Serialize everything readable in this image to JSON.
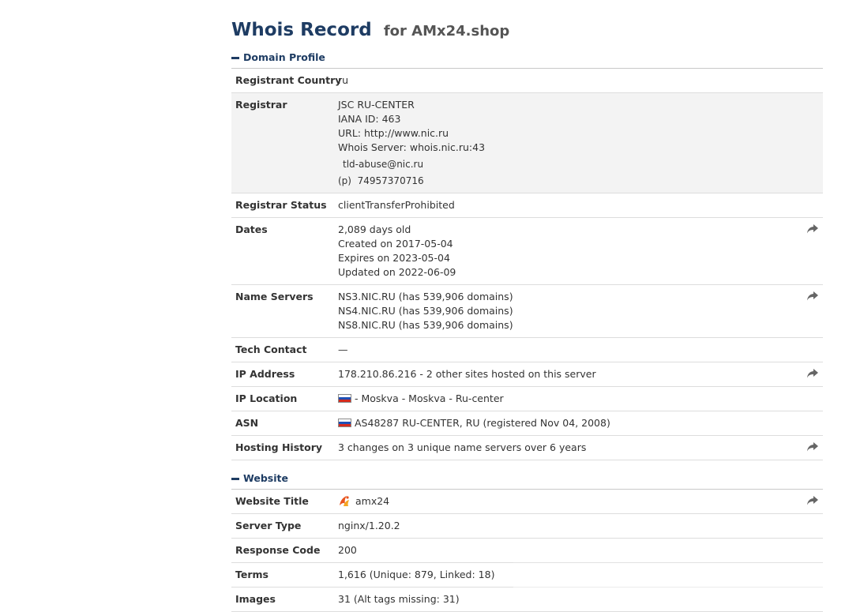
{
  "header": {
    "title": "Whois Record",
    "subtitle": "for AMx24.shop"
  },
  "sections": {
    "domain_profile": "Domain Profile",
    "website": "Website"
  },
  "rows": {
    "registrant_country": {
      "label": "Registrant Country",
      "value": "ru"
    },
    "registrar": {
      "label": "Registrar",
      "lines": [
        "JSC RU-CENTER",
        "IANA ID: 463",
        "URL: http://www.nic.ru",
        "Whois Server: whois.nic.ru:43"
      ],
      "email": "tld-abuse@nic.ru",
      "phone_prefix": "(p)",
      "phone": "74957370716"
    },
    "registrar_status": {
      "label": "Registrar Status",
      "value": "clientTransferProhibited"
    },
    "dates": {
      "label": "Dates",
      "lines": [
        "2,089 days old",
        "Created on 2017-05-04",
        "Expires on 2023-05-04",
        "Updated on 2022-06-09"
      ]
    },
    "name_servers": {
      "label": "Name Servers",
      "lines": [
        "NS3.NIC.RU (has 539,906 domains)",
        "NS4.NIC.RU (has 539,906 domains)",
        "NS8.NIC.RU (has 539,906 domains)"
      ]
    },
    "tech_contact": {
      "label": "Tech Contact",
      "value": "—"
    },
    "ip_address": {
      "label": "IP Address",
      "value": "178.210.86.216 - 2 other sites hosted on this server"
    },
    "ip_location": {
      "label": "IP Location",
      "value": "- Moskva - Moskva - Ru-center"
    },
    "asn": {
      "label": "ASN",
      "value": "AS48287 RU-CENTER, RU (registered Nov 04, 2008)"
    },
    "hosting_history": {
      "label": "Hosting History",
      "value": "3 changes on 3 unique name servers over 6 years"
    },
    "website_title": {
      "label": "Website Title",
      "value": "amx24"
    },
    "server_type": {
      "label": "Server Type",
      "value": "nginx/1.20.2"
    },
    "response_code": {
      "label": "Response Code",
      "value": "200"
    },
    "terms": {
      "label": "Terms",
      "value": "1,616 (Unique: 879, Linked: 18)"
    },
    "images": {
      "label": "Images",
      "value": "31 (Alt tags missing: 31)"
    }
  },
  "icons": {
    "share": "share-arrow-icon",
    "flag": "russia-flag-icon",
    "favicon": "site-favicon-icon"
  },
  "colors": {
    "heading": "#1e3c63",
    "flag_white": "#ffffff",
    "flag_blue": "#1f4fb5",
    "flag_red": "#d52b1e"
  }
}
